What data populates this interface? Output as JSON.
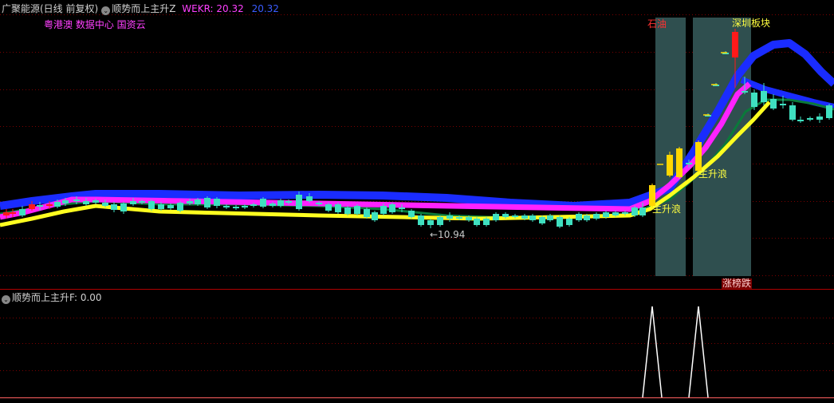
{
  "header": {
    "stock_label": "广聚能源(日线 前复权)",
    "indicator_name": "顺势而上主升Z",
    "wekr_label": "WEKR: 20.32",
    "wekr_value2": "20.32",
    "concepts": "粤港澳 数据中心 国资云"
  },
  "sub_header": {
    "indicator_name": "顺势而上主升F",
    "value": ": 0.00"
  },
  "annotations": {
    "low_price": "←10.94",
    "zone1_top": "石油",
    "zone2_top": "深圳板块",
    "zone2_bottom": "涨榜跌",
    "wave1": "主升浪",
    "wave2": "主升浪"
  },
  "colors": {
    "background": "#000000",
    "grid": "#7a0000",
    "up_candle": "#ff1a1a",
    "down_candle": "#3fe0c0",
    "band_blue": "#1a2cff",
    "band_magenta": "#ff22ff",
    "band_yellow": "#ffff20",
    "band_green": "#0a7a3a",
    "zone_fill": "#2f4f4f",
    "signal_bar": "#ffd700"
  },
  "chart_data": {
    "type": "candlestick",
    "price_low_marker": 10.94,
    "zones": [
      {
        "start_index": 79,
        "end_index": 82,
        "label_top": "石油"
      },
      {
        "start_index": 84,
        "end_index": 90,
        "label_top": "深圳板块",
        "label_bottom": "涨榜跌"
      }
    ],
    "subchart": {
      "name": "顺势而上主升F",
      "current_value": 0.0,
      "spikes_at_index": [
        80,
        85
      ]
    }
  }
}
